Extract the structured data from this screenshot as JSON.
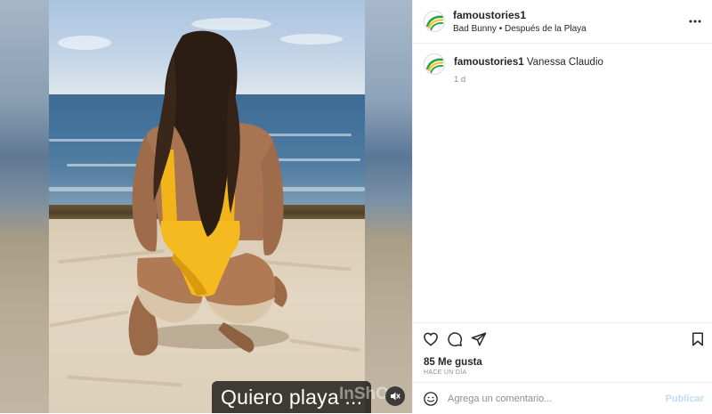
{
  "post": {
    "media": {
      "caption": "Quiero playa ...",
      "watermark": "InShO",
      "mute_icon": "speaker-muted-icon"
    },
    "header": {
      "username": "famoustories1",
      "music_artist": "Bad Bunny",
      "music_separator": "•",
      "music_track": "Después de la Playa",
      "more_icon": "more-dots-icon"
    },
    "comment": {
      "username": "famoustories1",
      "text": "Vanessa Claudio",
      "time": "1 d"
    },
    "actions": {
      "like_icon": "heart-icon",
      "comment_icon": "comment-bubble-icon",
      "share_icon": "paper-plane-icon",
      "save_icon": "bookmark-icon"
    },
    "likes_text": "85 Me gusta",
    "time_ago": "HACE UN DÍA",
    "add_comment": {
      "emoji_icon": "emoji-icon",
      "placeholder": "Agrega un comentario...",
      "publish_label": "Publicar"
    },
    "colors": {
      "text": "#262626",
      "muted": "#8e8e8e",
      "publish_disabled": "#c1dcf5",
      "divider": "#efefef"
    }
  }
}
